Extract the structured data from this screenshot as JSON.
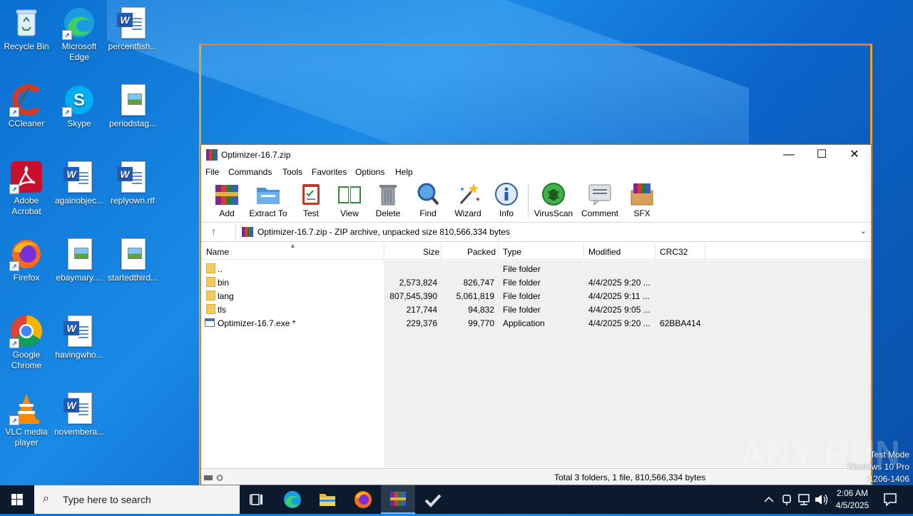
{
  "desktop": {
    "icons": [
      {
        "label": "Recycle Bin",
        "icon": "recycle-bin-icon"
      },
      {
        "label": "Microsoft Edge",
        "icon": "edge-icon"
      },
      {
        "label": "percentfish...",
        "icon": "word-doc-icon"
      },
      {
        "label": "CCleaner",
        "icon": "ccleaner-icon"
      },
      {
        "label": "Skype",
        "icon": "skype-icon"
      },
      {
        "label": "periodstag...",
        "icon": "image-file-icon"
      },
      {
        "label": "Adobe Acrobat",
        "icon": "acrobat-icon"
      },
      {
        "label": "againobjec...",
        "icon": "word-doc-icon"
      },
      {
        "label": "replyown.rtf",
        "icon": "word-doc-icon"
      },
      {
        "label": "Firefox",
        "icon": "firefox-icon"
      },
      {
        "label": "ebaymary....",
        "icon": "image-file-icon"
      },
      {
        "label": "startedthird...",
        "icon": "image-file-icon"
      },
      {
        "label": "Google Chrome",
        "icon": "chrome-icon"
      },
      {
        "label": "havingwho...",
        "icon": "word-doc-icon"
      },
      {
        "label": "VLC media player",
        "icon": "vlc-icon"
      },
      {
        "label": "novembera...",
        "icon": "word-doc-icon"
      }
    ]
  },
  "window": {
    "title": "Optimizer-16.7.zip",
    "controls": {
      "minimize": "—",
      "maximize": "☐",
      "close": "✕"
    },
    "menu": [
      "File",
      "Commands",
      "Tools",
      "Favorites",
      "Options",
      "Help"
    ],
    "toolbar": [
      "Add",
      "Extract To",
      "Test",
      "View",
      "Delete",
      "Find",
      "Wizard",
      "Info",
      "VirusScan",
      "Comment",
      "SFX"
    ],
    "address": "Optimizer-16.7.zip - ZIP archive, unpacked size 810,566,334 bytes",
    "columns": [
      "Name",
      "Size",
      "Packed",
      "Type",
      "Modified",
      "CRC32"
    ],
    "rows": [
      {
        "name": "..",
        "size": "",
        "packed": "",
        "type": "File folder",
        "modified": "",
        "crc": "",
        "kind": "folder"
      },
      {
        "name": "bin",
        "size": "2,573,824",
        "packed": "826,747",
        "type": "File folder",
        "modified": "4/4/2025 9:20 ...",
        "crc": "",
        "kind": "folder"
      },
      {
        "name": "lang",
        "size": "807,545,390",
        "packed": "5,061,819",
        "type": "File folder",
        "modified": "4/4/2025 9:11 ...",
        "crc": "",
        "kind": "folder"
      },
      {
        "name": "tls",
        "size": "217,744",
        "packed": "94,832",
        "type": "File folder",
        "modified": "4/4/2025 9:05 ...",
        "crc": "",
        "kind": "folder"
      },
      {
        "name": "Optimizer-16.7.exe *",
        "size": "229,376",
        "packed": "99,770",
        "type": "Application",
        "modified": "4/4/2025 9:20 ...",
        "crc": "62BBA414",
        "kind": "exe"
      }
    ],
    "status": "Total 3 folders, 1 file, 810,566,334 bytes"
  },
  "taskbar": {
    "search_placeholder": "Type here to search",
    "time": "2:06 AM",
    "date": "4/5/2025"
  },
  "watermark": {
    "line1": "Test Mode",
    "line2": "Windows 10 Pro",
    "line3": "Build 19041.vb_release.191206-1406",
    "brand": "ANY RUN"
  }
}
